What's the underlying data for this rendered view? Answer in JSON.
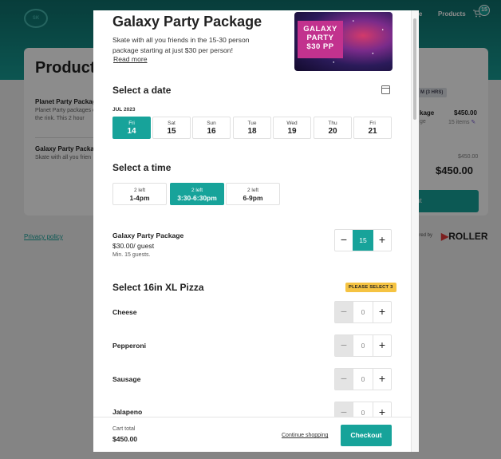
{
  "background": {
    "nav_item_partial": "ne",
    "nav_products": "Products",
    "cart_count": "15",
    "products_title": "Products",
    "items": [
      {
        "title": "Planet Party Packag",
        "desc": "Planet Party packages of the rink. This 2 hour"
      },
      {
        "title": "Galaxy Party Packa",
        "desc": "Skate with all you frien"
      }
    ],
    "privacy": "Privacy policy",
    "summary_badge": "M (3 HRS)",
    "summary_item": "kage",
    "summary_item_price": "$450.00",
    "summary_item_meta": "ge",
    "summary_items_count": "15 items",
    "summary_subtotal": "$450.00",
    "summary_total": "$450.00",
    "summary_btn_partial": "ut",
    "powered_by": "ered by",
    "roller": "ROLLER"
  },
  "modal": {
    "title": "Galaxy Party Package",
    "description": "Skate with all you friends in the 15-30 person package starting at just $30 per person!",
    "read_more": "Read more",
    "image_label_lines": [
      "GALAXY",
      "PARTY",
      "$30 PP"
    ],
    "date_section": {
      "title": "Select a date",
      "month": "JUL 2023",
      "dates": [
        {
          "dow": "Fri",
          "num": "14",
          "selected": true
        },
        {
          "dow": "Sat",
          "num": "15",
          "selected": false
        },
        {
          "dow": "Sun",
          "num": "16",
          "selected": false
        },
        {
          "dow": "Tue",
          "num": "18",
          "selected": false
        },
        {
          "dow": "Wed",
          "num": "19",
          "selected": false
        },
        {
          "dow": "Thu",
          "num": "20",
          "selected": false
        },
        {
          "dow": "Fri",
          "num": "21",
          "selected": false
        }
      ]
    },
    "time_section": {
      "title": "Select a time",
      "times": [
        {
          "left": "2 left",
          "range": "1-4pm",
          "selected": false
        },
        {
          "left": "2 left",
          "range": "3:30-6:30pm",
          "selected": true
        },
        {
          "left": "2 left",
          "range": "6-9pm",
          "selected": false
        }
      ]
    },
    "package": {
      "name": "Galaxy Party Package",
      "price": "$30.00/ guest",
      "min": "Min. 15 guests.",
      "quantity": "15",
      "minus": "−",
      "plus": "+"
    },
    "pizza_section": {
      "title": "Select 16in XL Pizza",
      "badge": "PLEASE SELECT 3",
      "options": [
        {
          "name": "Cheese",
          "quantity": "0"
        },
        {
          "name": "Pepperoni",
          "quantity": "0"
        },
        {
          "name": "Sausage",
          "quantity": "0"
        },
        {
          "name": "Jalapeno",
          "quantity": "0"
        }
      ]
    },
    "footer": {
      "cart_total_label": "Cart total",
      "cart_total": "$450.00",
      "continue": "Continue shopping",
      "checkout": "Checkout"
    }
  },
  "colors": {
    "accent": "#17a39a",
    "badge": "#f5c342",
    "image_label": "#c2328e"
  }
}
